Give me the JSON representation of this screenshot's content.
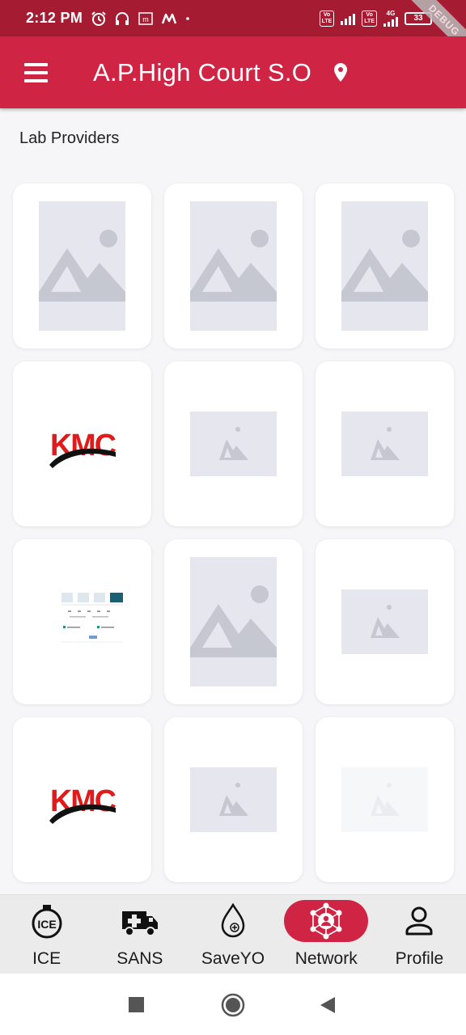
{
  "status_bar": {
    "time": "2:12 PM",
    "left_icons": [
      "alarm-icon",
      "headset-icon",
      "m-app-icon",
      "myntra-icon",
      "dot-icon"
    ],
    "lte1": "Vo\nLTE",
    "lte2": "Vo\nLTE",
    "network": "4G",
    "battery": "33",
    "debug_banner": "DEBUG"
  },
  "app_bar": {
    "title": "A.P.High Court S.O",
    "menu_icon": "hamburger-menu-icon",
    "location_icon": "location-pin-icon",
    "color": "#cf2443"
  },
  "section": {
    "title": "Lab Providers"
  },
  "providers": [
    {
      "type": "placeholder-large"
    },
    {
      "type": "placeholder-large"
    },
    {
      "type": "placeholder-large"
    },
    {
      "type": "kmc-logo",
      "logo_text": "KMC"
    },
    {
      "type": "placeholder-small"
    },
    {
      "type": "placeholder-small"
    },
    {
      "type": "screenshot"
    },
    {
      "type": "placeholder-large"
    },
    {
      "type": "placeholder-small"
    },
    {
      "type": "kmc-logo",
      "logo_text": "KMC"
    },
    {
      "type": "placeholder-small"
    },
    {
      "type": "placeholder-small-faded"
    }
  ],
  "bottom_nav": {
    "items": [
      {
        "label": "ICE",
        "icon": "ice-icon",
        "active": false
      },
      {
        "label": "SANS",
        "icon": "ambulance-icon",
        "active": false
      },
      {
        "label": "SaveYO",
        "icon": "blood-drop-icon",
        "active": false
      },
      {
        "label": "Network",
        "icon": "network-icon",
        "active": true
      },
      {
        "label": "Profile",
        "icon": "person-icon",
        "active": false
      }
    ]
  },
  "system_nav": [
    "recents-square-icon",
    "home-circle-icon",
    "back-triangle-icon"
  ]
}
